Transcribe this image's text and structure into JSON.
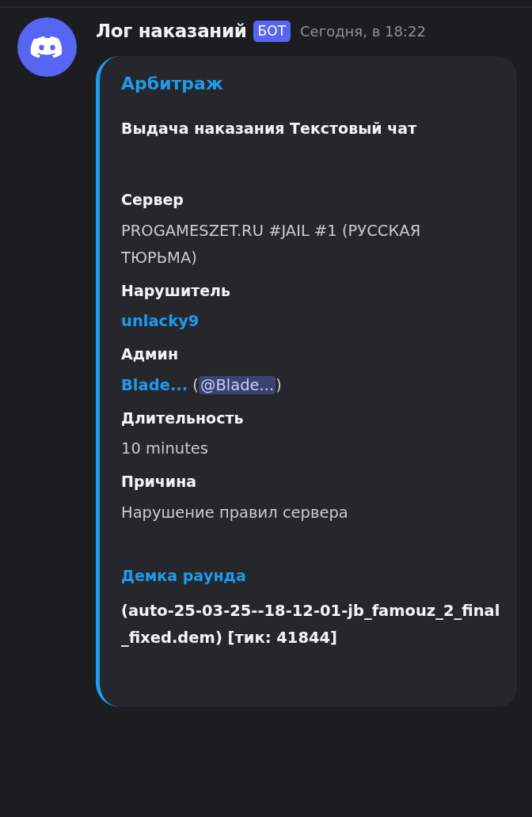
{
  "message": {
    "author": "Лог наказаний",
    "badge": "БОТ",
    "timestamp": "Сегодня, в 18:22"
  },
  "embed": {
    "color": "#1e9bea",
    "title": "Арбитраж",
    "description": "Выдача наказания Текстовый чат",
    "fields": [
      {
        "kind": "plain",
        "name": "Сервер",
        "value": [
          {
            "kind": "text",
            "text": "PROGAMESZET.RU #JAIL #1 (РУССКАЯ ТЮРЬМА)"
          }
        ]
      },
      {
        "kind": "plain",
        "name": "Нарушитель",
        "value": [
          {
            "kind": "link",
            "text": "unlacky9"
          }
        ]
      },
      {
        "kind": "plain",
        "name": "Админ",
        "value": [
          {
            "kind": "link",
            "text": "Blade..."
          },
          {
            "kind": "text",
            "text": " ("
          },
          {
            "kind": "mention",
            "text": "@Blade..."
          },
          {
            "kind": "text",
            "text": ")"
          }
        ]
      },
      {
        "kind": "plain",
        "name": "Длительность",
        "value": [
          {
            "kind": "text",
            "text": "10 minutes"
          }
        ]
      },
      {
        "kind": "plain",
        "name": "Причина",
        "value": [
          {
            "kind": "text",
            "text": "Нарушение правил сервера"
          }
        ]
      },
      {
        "kind": "linked",
        "name": "Демка раунда",
        "value": [
          {
            "kind": "bold",
            "text": "(auto-25-03-25--18-12-01-jb_famouz_2_final_fixed.dem) [тик: 41844]"
          }
        ]
      }
    ]
  }
}
